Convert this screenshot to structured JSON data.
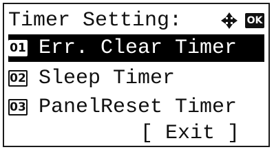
{
  "header": {
    "title": "Timer Setting:",
    "nav_icon": "four-way-arrows-icon",
    "ok_label": "OK"
  },
  "menu": {
    "items": [
      {
        "number": "01",
        "label": "Err. Clear Timer",
        "selected": true
      },
      {
        "number": "02",
        "label": "Sleep Timer",
        "selected": false
      },
      {
        "number": "03",
        "label": "PanelReset Timer",
        "selected": false
      }
    ]
  },
  "footer": {
    "exit_label": "[ Exit ]"
  },
  "colors": {
    "highlight_bg": "#000000",
    "highlight_fg": "#ffffff",
    "text": "#111111",
    "background": "#ffffff"
  }
}
